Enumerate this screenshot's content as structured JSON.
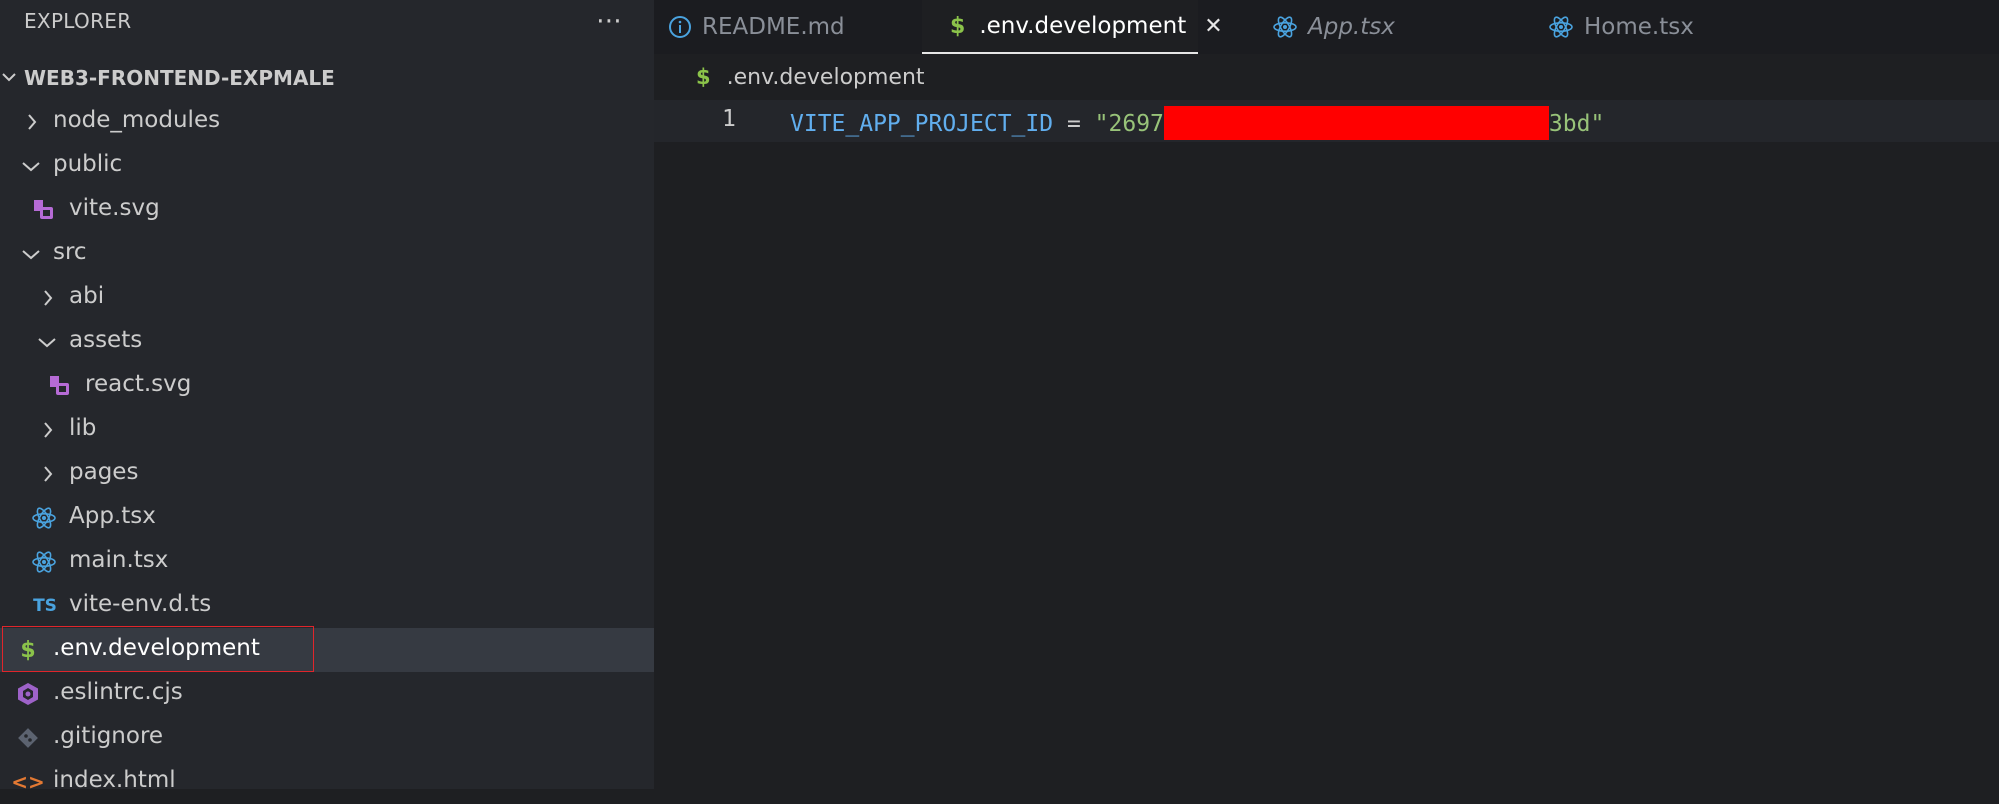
{
  "explorer": {
    "title": "EXPLORER",
    "more_label": "⋯",
    "root_label": "WEB3-FRONTEND-EXPMALE",
    "items": [
      {
        "label": "node_modules",
        "kind": "folder",
        "expanded": false
      },
      {
        "label": "public",
        "kind": "folder",
        "expanded": true
      },
      {
        "label": "vite.svg",
        "kind": "svg-file"
      },
      {
        "label": "src",
        "kind": "folder",
        "expanded": true
      },
      {
        "label": "abi",
        "kind": "folder",
        "expanded": false
      },
      {
        "label": "assets",
        "kind": "folder",
        "expanded": true
      },
      {
        "label": "react.svg",
        "kind": "svg-file"
      },
      {
        "label": "lib",
        "kind": "folder",
        "expanded": false
      },
      {
        "label": "pages",
        "kind": "folder",
        "expanded": false
      },
      {
        "label": "App.tsx",
        "kind": "react-file"
      },
      {
        "label": "main.tsx",
        "kind": "react-file"
      },
      {
        "label": "vite-env.d.ts",
        "kind": "ts-file",
        "badge": "TS"
      },
      {
        "label": ".env.development",
        "kind": "env-file",
        "selected": true
      },
      {
        "label": ".eslintrc.cjs",
        "kind": "eslint-file"
      },
      {
        "label": ".gitignore",
        "kind": "git-file"
      },
      {
        "label": "index.html",
        "kind": "html-file"
      }
    ]
  },
  "tabs": [
    {
      "label": "README.md",
      "icon": "info-icon"
    },
    {
      "label": ".env.development",
      "icon": "dollar-icon",
      "active": true,
      "close": "✕"
    },
    {
      "label": "App.tsx",
      "icon": "react-icon",
      "italic": true
    },
    {
      "label": "Home.tsx",
      "icon": "react-icon"
    }
  ],
  "editor": {
    "breadcrumb": ".env.development",
    "line_number": "1",
    "code": {
      "key": "VITE_APP_PROJECT_ID",
      "op": " = ",
      "value_start": "\"2697",
      "value_end": "3bd\""
    }
  },
  "colors": {
    "accent_selection_outline": "#e0252b",
    "redaction": "#ff0000",
    "env_icon": "#8bc34a",
    "react_icon": "#4aa3df",
    "svg_icon": "#b66bd6",
    "ts_badge": "#4aa3df"
  }
}
